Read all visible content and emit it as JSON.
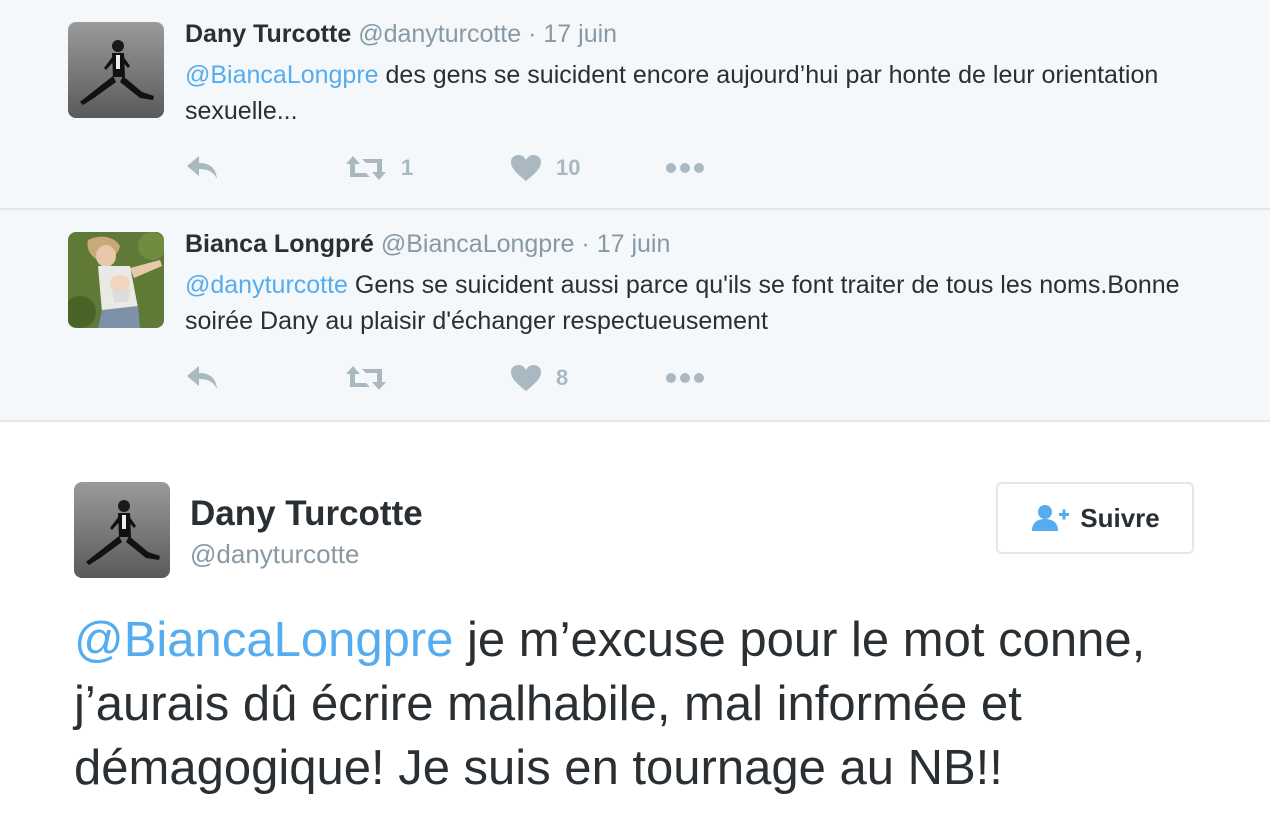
{
  "tweets": [
    {
      "name": "Dany Turcotte",
      "handle": "@danyturcotte",
      "separator": "·",
      "date": "17 juin",
      "mention": "@BiancaLongpre",
      "text": " des gens se suicident encore aujourd’hui par honte de leur orientation sexuelle...",
      "retweets": "1",
      "likes": "10",
      "avatar_icon": "jumping-man-avatar"
    },
    {
      "name": "Bianca Longpré",
      "handle": "@BiancaLongpre",
      "separator": "·",
      "date": "17 juin",
      "mention": "@danyturcotte",
      "text": " Gens se suicident aussi parce qu'ils se font traiter de tous les noms.Bonne soirée Dany au plaisir d'échanger respectueusement",
      "retweets": "",
      "likes": "8",
      "avatar_icon": "woman-with-baby-avatar"
    }
  ],
  "main_tweet": {
    "name": "Dany Turcotte",
    "handle": "@danyturcotte",
    "follow_label": "Suivre",
    "mention": "@BiancaLongpre",
    "text": " je m’excuse pour le mot conne, j’aurais dû écrire malhabile, mal informée et démagogique! Je suis en tournage au NB!!"
  },
  "colors": {
    "link": "#55acee",
    "muted": "#8899a6",
    "action_icon": "#aab8c2",
    "text": "#292f33",
    "reply_bg": "#f5f8fa"
  }
}
